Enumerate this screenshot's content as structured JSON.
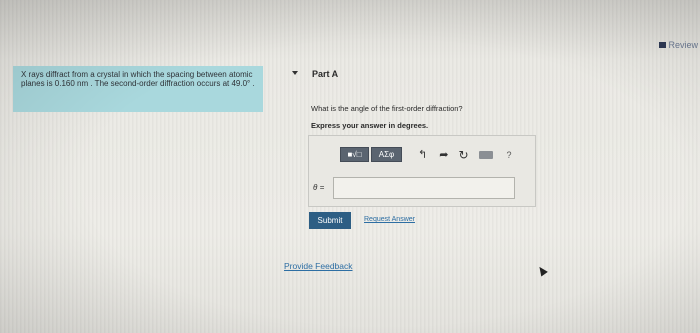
{
  "header": {
    "review_label": "Review"
  },
  "problem": {
    "text": "X rays diffract from a crystal in which the spacing between atomic planes is 0.160 nm . The second-order diffraction occurs at 49.0° ."
  },
  "part": {
    "title": "Part A",
    "question": "What is the angle of the first-order diffraction?",
    "instruction": "Express your answer in degrees."
  },
  "toolbar": {
    "math_template_label": "■√□",
    "greek_label": "ΑΣφ",
    "undo_icon": "↰",
    "redo_icon": "➦",
    "reset_icon": "↻",
    "help_label": "?"
  },
  "answer": {
    "variable_label": "θ =",
    "value": ""
  },
  "actions": {
    "submit_label": "Submit",
    "request_answer_label": "Request Answer"
  },
  "footer": {
    "feedback_label": "Provide Feedback"
  },
  "colors": {
    "problem_bg": "#a9d8dd",
    "submit_bg": "#2d5e84",
    "link": "#2d6ea3"
  }
}
